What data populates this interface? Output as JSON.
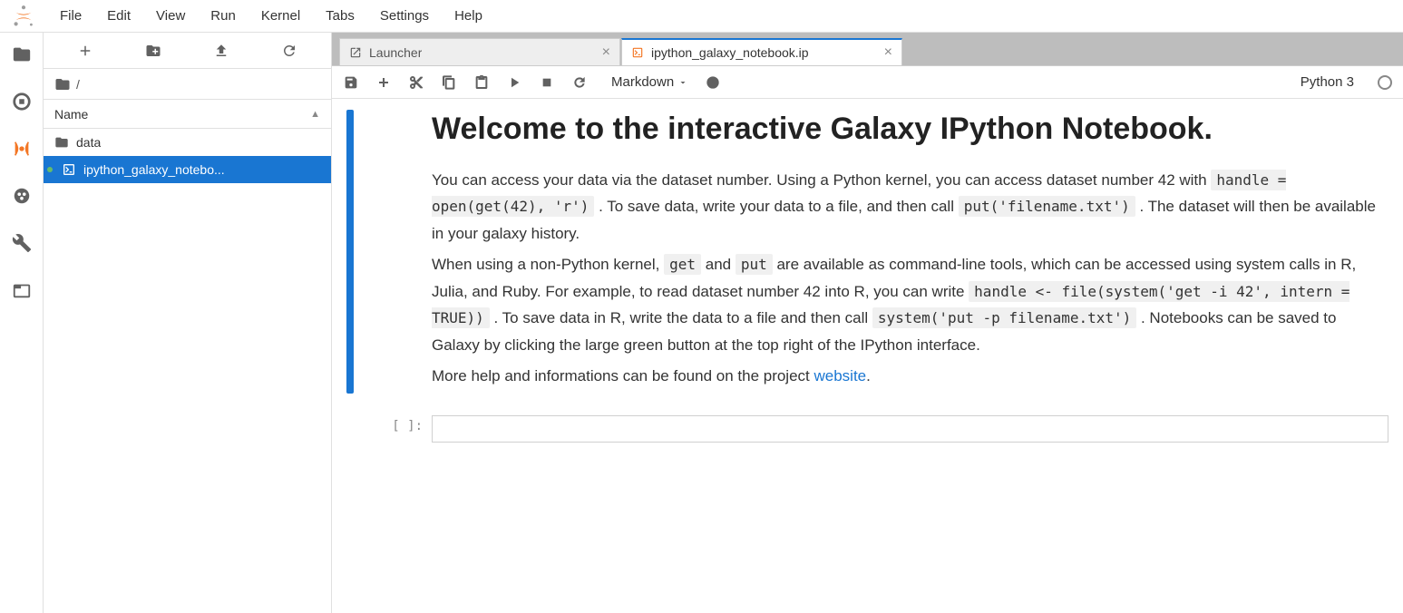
{
  "menu": [
    "File",
    "Edit",
    "View",
    "Run",
    "Kernel",
    "Tabs",
    "Settings",
    "Help"
  ],
  "file_browser": {
    "breadcrumb": "/",
    "header": "Name",
    "items": [
      {
        "type": "folder",
        "name": "data",
        "selected": false,
        "running": false
      },
      {
        "type": "notebook",
        "name": "ipython_galaxy_notebo...",
        "selected": true,
        "running": true
      }
    ]
  },
  "tabs": [
    {
      "icon": "launcher",
      "label": "Launcher",
      "active": false
    },
    {
      "icon": "notebook",
      "label": "ipython_galaxy_notebook.ip",
      "active": true
    }
  ],
  "notebook_toolbar": {
    "cell_type": "Markdown",
    "kernel": "Python 3"
  },
  "markdown": {
    "heading": "Welcome to the interactive Galaxy IPython Notebook.",
    "p1a": "You can access your data via the dataset number. Using a Python kernel, you can access dataset number 42 with ",
    "code1": "handle = open(get(42), 'r')",
    "p1b": " . To save data, write your data to a file, and then call ",
    "code2": "put('filename.txt')",
    "p1c": " . The dataset will then be available in your galaxy history.",
    "p2a": "When using a non-Python kernel, ",
    "code3": "get",
    "p2b": " and ",
    "code4": "put",
    "p2c": " are available as command-line tools, which can be accessed using system calls in R, Julia, and Ruby. For example, to read dataset number 42 into R, you can write ",
    "code5": "handle <- file(system('get -i 42', intern = TRUE))",
    "p2d": " . To save data in R, write the data to a file and then call ",
    "code6": "system('put -p filename.txt')",
    "p2e": " . Notebooks can be saved to Galaxy by clicking the large green button at the top right of the IPython interface.",
    "p3a": "More help and informations can be found on the project ",
    "link": "website",
    "p3b": "."
  },
  "code_prompt": "[ ]:"
}
